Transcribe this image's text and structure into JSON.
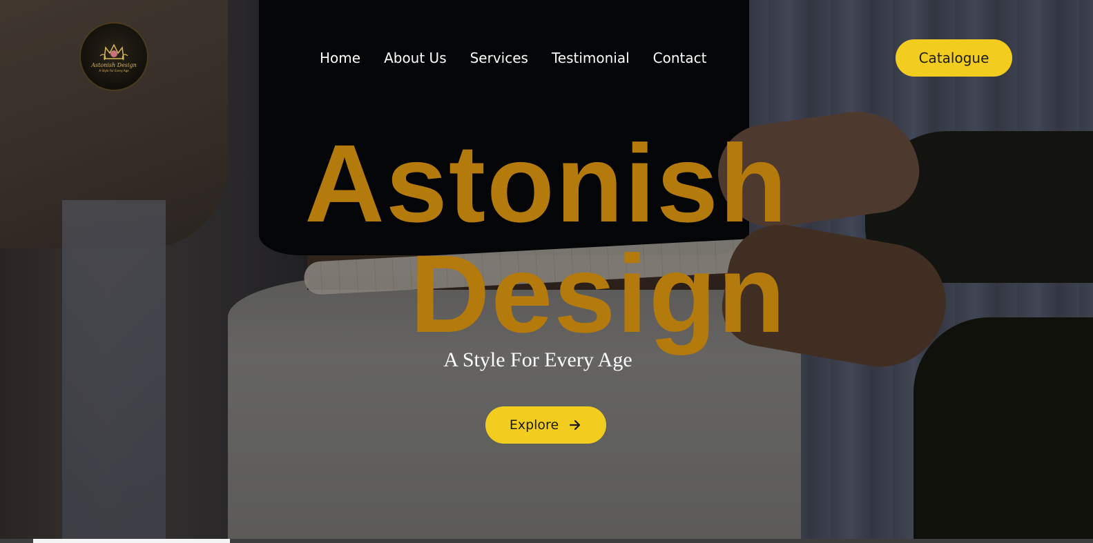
{
  "brand": {
    "logo_title": "Astonish Design",
    "logo_tagline": "A Style For Every Age"
  },
  "nav": {
    "items": [
      {
        "label": "Home"
      },
      {
        "label": "About Us"
      },
      {
        "label": "Services"
      },
      {
        "label": "Testimonial"
      },
      {
        "label": "Contact"
      }
    ],
    "catalogue_label": "Catalogue"
  },
  "hero": {
    "title_line1": "Astonish",
    "title_line2": "Design",
    "subtitle": "A Style For Every Age",
    "cta_label": "Explore",
    "cta_icon": "arrow-right-icon",
    "background_image": "tailor-measuring-waist-photo"
  },
  "colors": {
    "accent": "#f2cd1f",
    "title": "#b57a0c",
    "nav_text": "#ffffff"
  }
}
